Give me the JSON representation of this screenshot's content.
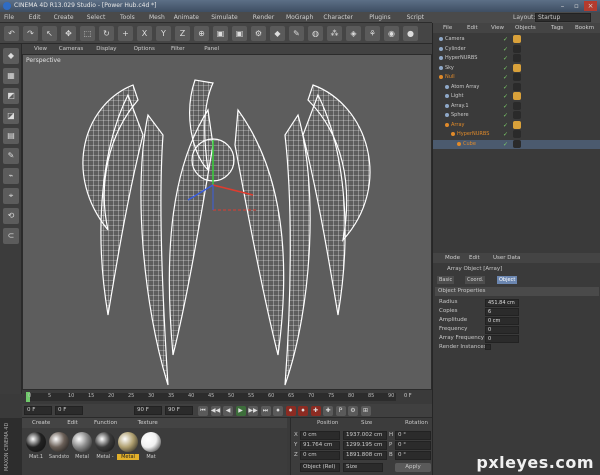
{
  "window": {
    "title": "CINEMA 4D R13.029 Studio - [Power Hub.c4d *]",
    "layout_label": "Layout:",
    "layout_value": "Startup"
  },
  "menu": [
    "File",
    "Edit",
    "Create",
    "Select",
    "Tools",
    "Mesh",
    "Animate",
    "Simulate",
    "Render",
    "MoGraph",
    "Character",
    "Plugins",
    "Script",
    "Window",
    "Help"
  ],
  "toolbar_icons": [
    "undo-icon",
    "redo-icon",
    "live-select-icon",
    "move-icon",
    "scale-icon",
    "rotate-icon",
    "add-icon",
    "x-axis-icon",
    "y-axis-icon",
    "z-axis-icon",
    "world-coord-icon",
    "render-view-icon",
    "render-picture-icon",
    "render-settings-icon",
    "cube-icon",
    "pen-icon",
    "subdivision-icon",
    "array-icon",
    "deformer-icon",
    "scene-icon",
    "camera-icon",
    "light-icon"
  ],
  "toolbar_labels": [
    "↶",
    "↷",
    "↖",
    "✥",
    "⬚",
    "↻",
    "+",
    "X",
    "Y",
    "Z",
    "⊕",
    "▣",
    "▣",
    "⚙",
    "◆",
    "✎",
    "◍",
    "⁂",
    "◈",
    "⚘",
    "◉",
    "●"
  ],
  "left_tools": [
    "◆",
    "▦",
    "◩",
    "◪",
    "▤",
    "✎",
    "⌁",
    "⌖",
    "⟲",
    "⊂"
  ],
  "viewport": {
    "menu": [
      "View",
      "Cameras",
      "Display",
      "Options",
      "Filter",
      "Panel"
    ],
    "label": "Perspective"
  },
  "timeline": {
    "ticks": [
      "0",
      "5",
      "10",
      "15",
      "20",
      "25",
      "30",
      "35",
      "40",
      "45",
      "50",
      "55",
      "60",
      "65",
      "70",
      "75",
      "80",
      "85",
      "90"
    ],
    "end_label": "0 F"
  },
  "transport": {
    "start": "0 F",
    "current": "0 F",
    "end": "90 F",
    "end2": "90 F",
    "buttons": [
      "⏮",
      "◀◀",
      "◀",
      "▶",
      "▶▶",
      "⏭",
      "⏺",
      "⏺",
      "⏺",
      "✚",
      "✚",
      "P",
      "⚙",
      "⊞"
    ]
  },
  "materials": {
    "menu": [
      "Create",
      "Edit",
      "Function",
      "Texture"
    ],
    "items": [
      {
        "name": "Mat.1",
        "color": "#222222"
      },
      {
        "name": "Sandsto",
        "color": "#6b6058"
      },
      {
        "name": "Metal",
        "color": "#8a8a8a"
      },
      {
        "name": "Metal -",
        "color": "#3a3a3a"
      },
      {
        "name": "Metal",
        "color": "#b0a070"
      },
      {
        "name": "Mat",
        "color": "#f0f0f0"
      }
    ]
  },
  "coords": {
    "headers": [
      "Position",
      "Size",
      "Rotation"
    ],
    "rows": [
      {
        "axis": "X",
        "pos": "0 cm",
        "size": "1937.002 cm",
        "rlabel": "H",
        "rot": "0 °"
      },
      {
        "axis": "Y",
        "pos": "91.764 cm",
        "size": "1299.195 cm",
        "rlabel": "P",
        "rot": "0 °"
      },
      {
        "axis": "Z",
        "pos": "0 cm",
        "size": "1891.808 cm",
        "rlabel": "B",
        "rot": "0 °"
      }
    ],
    "mode1": "Object (Rel)",
    "mode2": "Size",
    "apply": "Apply"
  },
  "branding": "MAXON CINEMA 4D",
  "objects": {
    "menu": [
      "File",
      "Edit",
      "View",
      "Objects",
      "Tags",
      "Bookm"
    ],
    "rows": [
      {
        "name": "Camera",
        "indent": 0,
        "color": "#c8c8c8"
      },
      {
        "name": "Cylinder",
        "indent": 0,
        "color": "#c8c8c8"
      },
      {
        "name": "HyperNURBS",
        "indent": 0,
        "color": "#c8c8c8"
      },
      {
        "name": "Sky",
        "indent": 0,
        "color": "#c8c8c8"
      },
      {
        "name": "Null",
        "indent": 0,
        "color": "#e08a2a"
      },
      {
        "name": "Atom Array",
        "indent": 1,
        "color": "#c8c8c8"
      },
      {
        "name": "Light",
        "indent": 1,
        "color": "#c8c8c8"
      },
      {
        "name": "Array.1",
        "indent": 1,
        "color": "#c8c8c8"
      },
      {
        "name": "Sphere",
        "indent": 1,
        "color": "#c8c8c8"
      },
      {
        "name": "Array",
        "indent": 1,
        "color": "#e08a2a"
      },
      {
        "name": "HyperNURBS",
        "indent": 2,
        "color": "#e08a2a"
      },
      {
        "name": "Cube",
        "indent": 3,
        "color": "#e08a2a"
      }
    ]
  },
  "attributes": {
    "menu": [
      "Mode",
      "Edit",
      "User Data"
    ],
    "object_title": "Array Object [Array]",
    "tabs": [
      "Basic",
      "Coord.",
      "Object"
    ],
    "section": "Object Properties",
    "props": [
      {
        "label": "Radius",
        "value": "451.84 cm"
      },
      {
        "label": "Copies",
        "value": "6"
      },
      {
        "label": "Amplitude",
        "value": "0 cm"
      },
      {
        "label": "Frequency",
        "value": "0"
      },
      {
        "label": "Array Frequency",
        "value": "0"
      },
      {
        "label": "Render Instances",
        "value": ""
      }
    ]
  },
  "watermark": "pxleyes.com"
}
